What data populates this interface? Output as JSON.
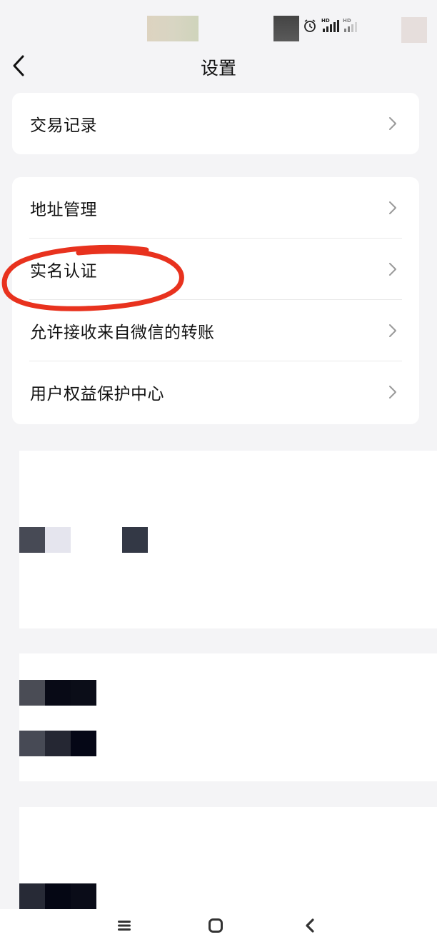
{
  "nav": {
    "title": "设置"
  },
  "groups": [
    {
      "items": [
        {
          "label": "交易记录"
        }
      ]
    },
    {
      "items": [
        {
          "label": "地址管理"
        },
        {
          "label": "实名认证"
        },
        {
          "label": "允许接收来自微信的转账"
        },
        {
          "label": "用户权益保护中心"
        }
      ]
    }
  ],
  "icons": {
    "back": "chevron-left-icon",
    "row_arrow": "chevron-right-icon",
    "menu": "menu-icon",
    "home": "home-icon",
    "back_system": "back-icon"
  },
  "colors": {
    "background": "#f4f4f6",
    "card": "#ffffff",
    "annotation": "#e8321e",
    "chevron": "#9a9a9a"
  }
}
